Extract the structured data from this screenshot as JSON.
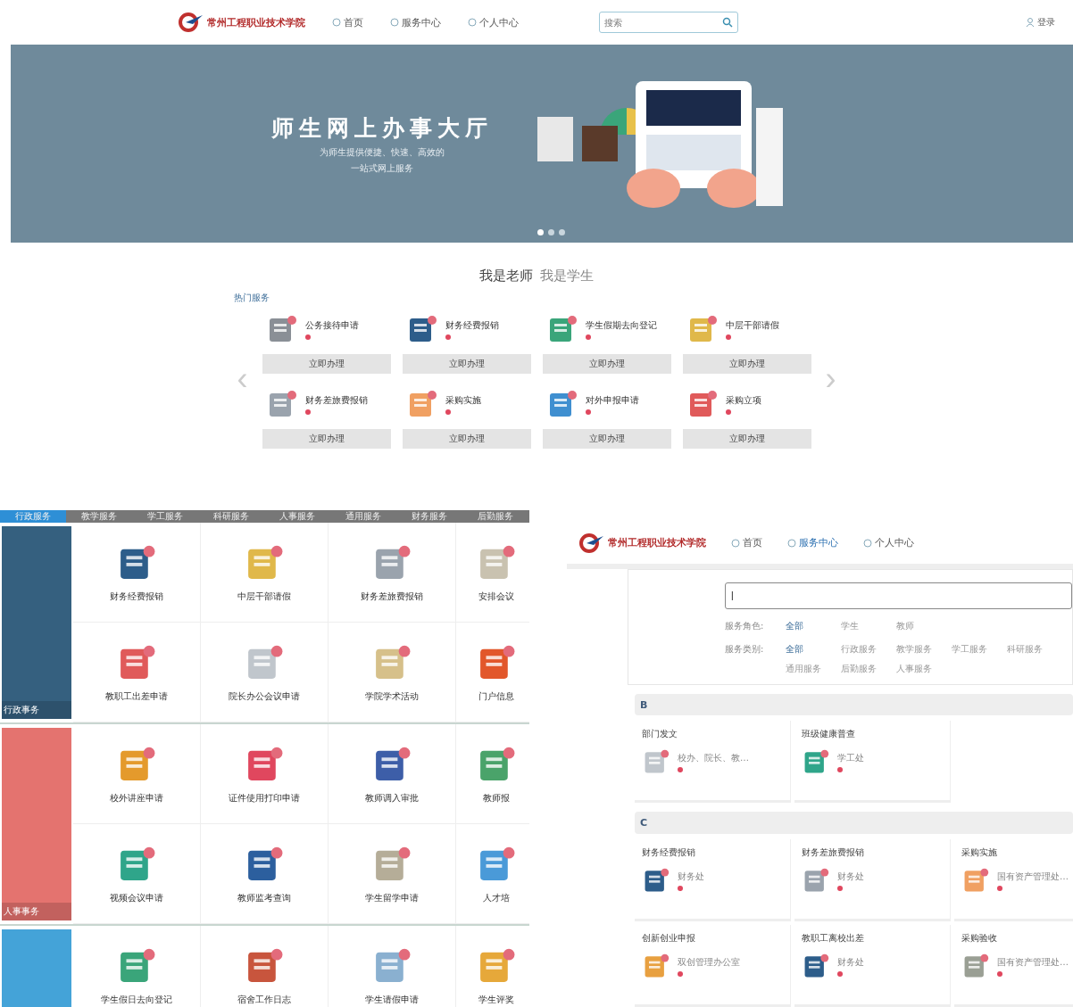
{
  "header": {
    "logo_text": "常州工程职业技术学院",
    "nav": [
      {
        "label": "首页",
        "selected": false
      },
      {
        "label": "服务中心",
        "selected": false
      },
      {
        "label": "个人中心",
        "selected": false
      }
    ],
    "search": {
      "placeholder": "搜索"
    },
    "login": "登录"
  },
  "banner": {
    "title": "师生网上办事大厅",
    "subtitle": [
      "为师生提供便捷、快速、高效的",
      "一站式网上服务"
    ],
    "dots": [
      {
        "selected": true
      },
      {
        "selected": false
      },
      {
        "selected": false
      }
    ]
  },
  "hot": {
    "roles": [
      {
        "label": "我是老师",
        "selected": true
      },
      {
        "label": "我是学生",
        "selected": false
      }
    ],
    "heading": "热门服务",
    "prev": "‹",
    "next": "›",
    "items": [
      {
        "name": "公务接待申请",
        "button": "立即办理",
        "color": "#8a8f96"
      },
      {
        "name": "财务经费报销",
        "button": "立即办理",
        "color": "#2d5d8a"
      },
      {
        "name": "学生假期去向登记",
        "button": "立即办理",
        "color": "#3aa57a"
      },
      {
        "name": "中层干部请假",
        "button": "立即办理",
        "color": "#e0b84a"
      },
      {
        "name": "财务差旅费报销",
        "button": "立即办理",
        "color": "#9aa3ad"
      },
      {
        "name": "采购实施",
        "button": "立即办理",
        "color": "#f0a062"
      },
      {
        "name": "对外申报申请",
        "button": "立即办理",
        "color": "#3f8fd0"
      },
      {
        "name": "采购立项",
        "button": "立即办理",
        "color": "#e05a5a"
      }
    ]
  },
  "catalog": {
    "tabs": [
      {
        "label": "行政服务",
        "selected": true
      },
      {
        "label": "教学服务",
        "selected": false
      },
      {
        "label": "学工服务",
        "selected": false
      },
      {
        "label": "科研服务",
        "selected": false
      },
      {
        "label": "人事服务",
        "selected": false
      },
      {
        "label": "通用服务",
        "selected": false
      },
      {
        "label": "财务服务",
        "selected": false
      },
      {
        "label": "后勤服务",
        "selected": false
      }
    ],
    "groups": [
      {
        "label": "行政事务",
        "color": "#35607f",
        "items": [
          {
            "name": "财务经费报销",
            "color": "#2d5d8a"
          },
          {
            "name": "中层干部请假",
            "color": "#e0b84a"
          },
          {
            "name": "财务差旅费报销",
            "color": "#9aa3ad"
          },
          {
            "name": "安排会议",
            "color": "#c9c2b0"
          },
          {
            "name": "教职工出差申请",
            "color": "#e05a5a"
          },
          {
            "name": "院长办公会议申请",
            "color": "#c0c6cc"
          },
          {
            "name": "学院学术活动",
            "color": "#d6c08a"
          },
          {
            "name": "门户信息",
            "color": "#e2572b"
          }
        ]
      },
      {
        "label": "人事事务",
        "color": "#e4736f",
        "items": [
          {
            "name": "校外讲座申请",
            "color": "#e49a2c"
          },
          {
            "name": "证件使用打印申请",
            "color": "#e0475e"
          },
          {
            "name": "教师调入审批",
            "color": "#3d5ea8"
          },
          {
            "name": "教师报",
            "color": "#4aa36a"
          },
          {
            "name": "视频会议申请",
            "color": "#2fa58a"
          },
          {
            "name": "教师监考查询",
            "color": "#2c5f9e"
          },
          {
            "name": "学生留学申请",
            "color": "#b5ad98"
          },
          {
            "name": "人才培",
            "color": "#4a9ad8"
          }
        ]
      },
      {
        "color": "#44a3d8",
        "items": [
          {
            "name": "学生假日去向登记",
            "color": "#3aa57a"
          },
          {
            "name": "宿舍工作日志",
            "color": "#c8553d"
          },
          {
            "name": "学生请假申请",
            "color": "#8ab0d0"
          },
          {
            "name": "学生评奖",
            "color": "#e6a83a"
          }
        ]
      }
    ]
  },
  "service_center": {
    "logo_text": "常州工程职业技术学院",
    "nav": [
      {
        "label": "首页",
        "selected": false
      },
      {
        "label": "服务中心",
        "selected": true
      },
      {
        "label": "个人中心",
        "selected": false
      }
    ],
    "search": {
      "value": "|"
    },
    "filters": [
      {
        "label": "服务角色:",
        "options": [
          {
            "label": "全部",
            "selected": true
          },
          {
            "label": "学生",
            "selected": false
          },
          {
            "label": "教师",
            "selected": false
          }
        ]
      },
      {
        "label": "服务类别:",
        "options": [
          {
            "label": "全部",
            "selected": true
          },
          {
            "label": "行政服务",
            "selected": false
          },
          {
            "label": "教学服务",
            "selected": false
          },
          {
            "label": "学工服务",
            "selected": false
          },
          {
            "label": "科研服务",
            "selected": false
          },
          {
            "label": "通用服务",
            "selected": false
          },
          {
            "label": "后勤服务",
            "selected": false
          },
          {
            "label": "人事服务",
            "selected": false
          }
        ]
      }
    ],
    "sections": [
      {
        "letter": "B",
        "items": [
          {
            "name": "部门发文",
            "owner": "校办、院长、教…",
            "color": "#c0c6cc"
          },
          {
            "name": "班级健康普查",
            "owner": "学工处",
            "color": "#2fa58a"
          }
        ]
      },
      {
        "letter": "C",
        "items": [
          {
            "name": "财务经费报销",
            "owner": "财务处",
            "color": "#2d5d8a"
          },
          {
            "name": "财务差旅费报销",
            "owner": "财务处",
            "color": "#9aa3ad"
          },
          {
            "name": "采购实施",
            "owner": "国有资产管理处…",
            "color": "#f0a062"
          },
          {
            "name": "创新创业申报",
            "owner": "双创管理办公室",
            "color": "#e8a040"
          },
          {
            "name": "教职工离校出差",
            "owner": "财务处",
            "color": "#2d5d8a"
          },
          {
            "name": "采购验收",
            "owner": "国有资产管理处…",
            "color": "#9a9f94"
          }
        ]
      }
    ]
  }
}
